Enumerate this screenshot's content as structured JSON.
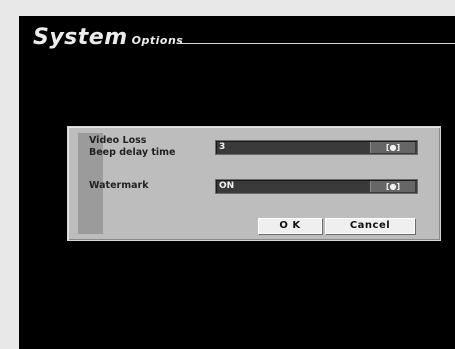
{
  "header": {
    "title_main": "System",
    "title_sub": "Options"
  },
  "dialog": {
    "rows": [
      {
        "label_line1": "Video Loss",
        "label_line2": "Beep delay time",
        "value": "3",
        "button_icon": "[●]"
      },
      {
        "label_line1": "Watermark",
        "value": "ON",
        "button_icon": "[●]"
      }
    ],
    "ok_label": "O K",
    "cancel_label": "Cancel"
  },
  "colors": {
    "screen_bg": "#000000",
    "dialog_bg": "#bdbdbd",
    "field_bg": "#3a3a3a",
    "button_bg": "#efefef"
  }
}
